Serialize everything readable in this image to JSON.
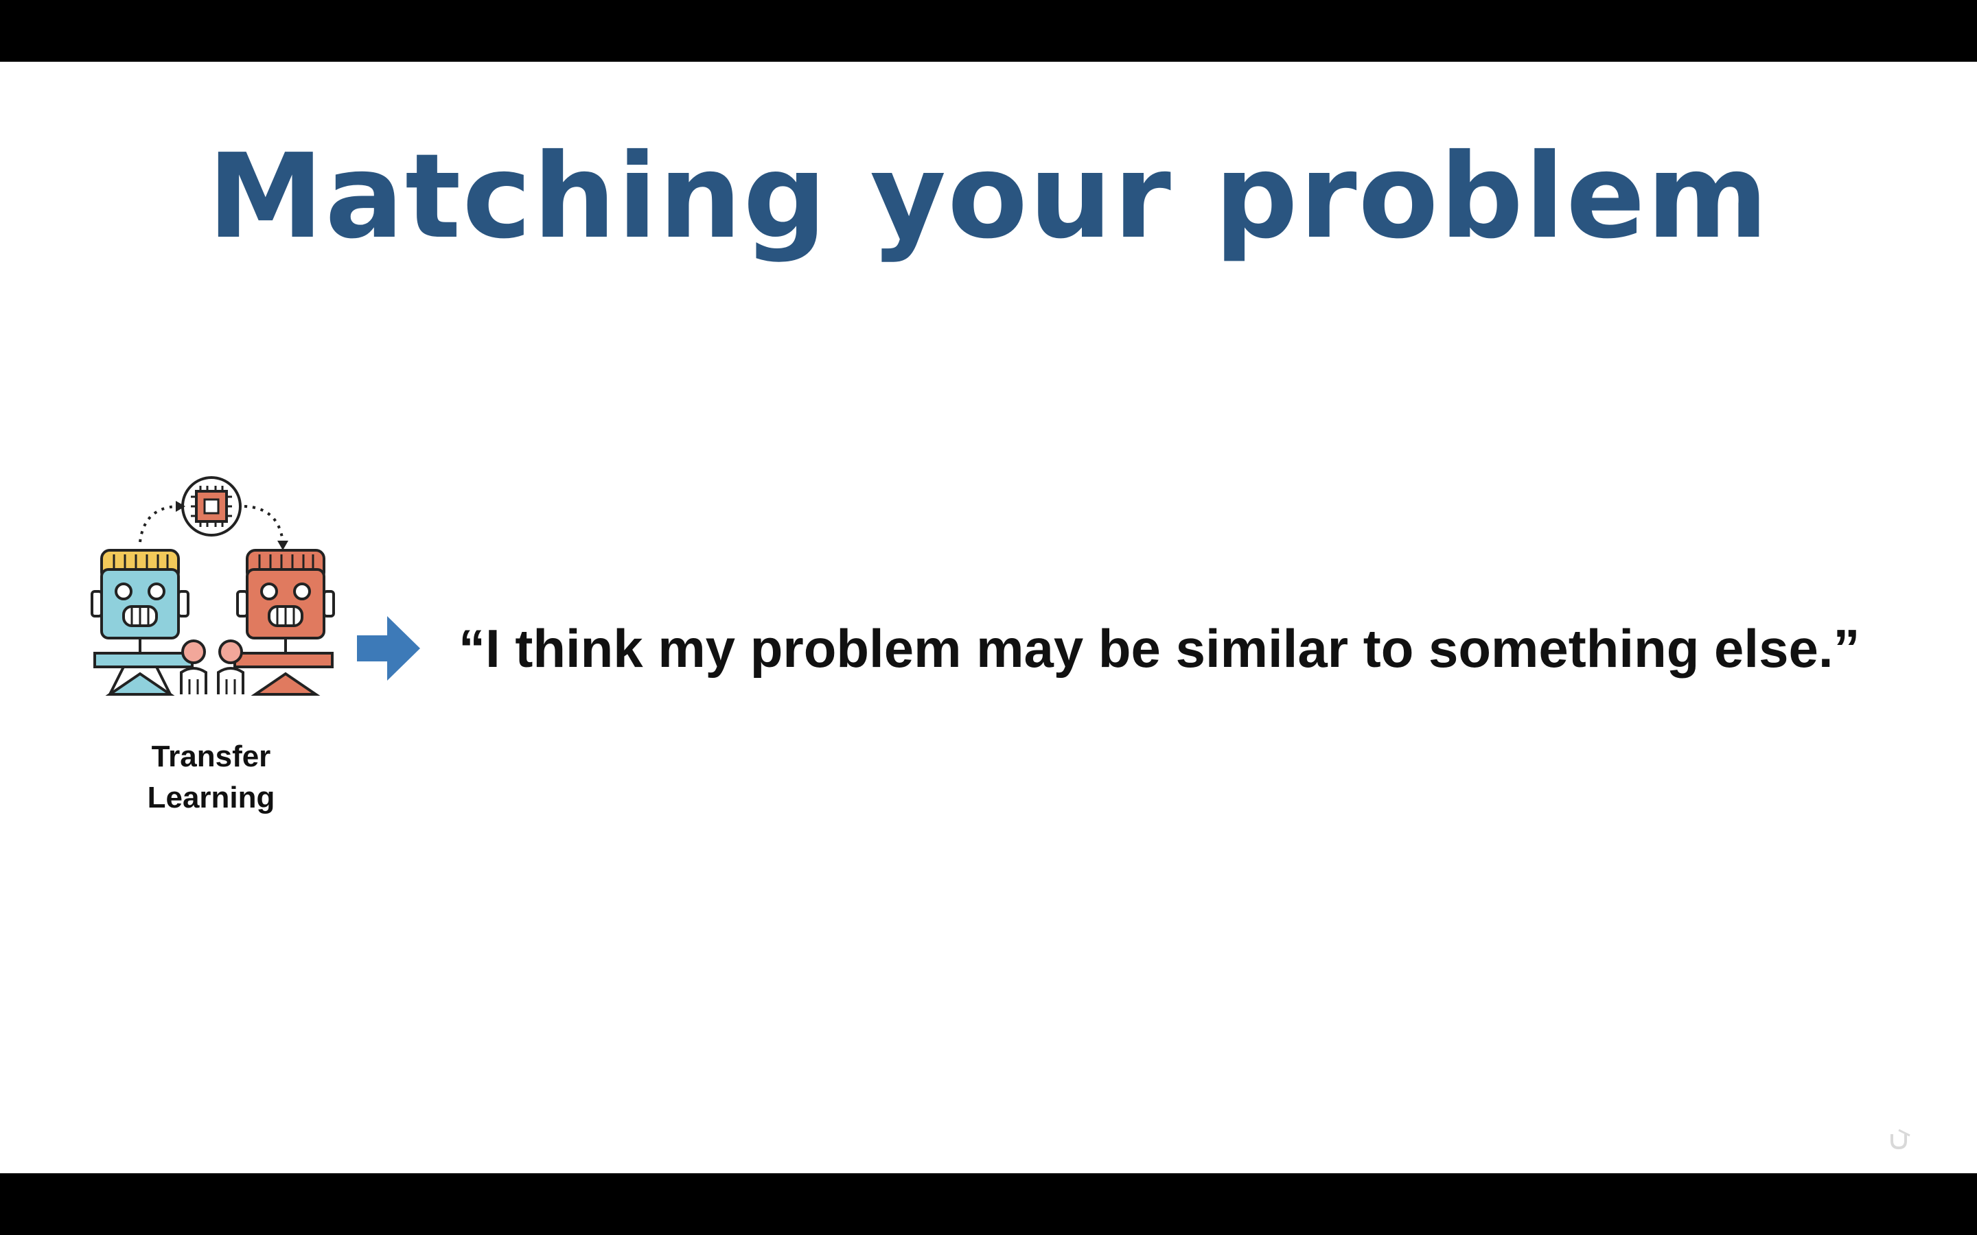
{
  "slide": {
    "title": "Matching your problem",
    "caption_line1": "Transfer",
    "caption_line2": "Learning",
    "quote": "“I think my problem may be similar to something else.”"
  },
  "icons": {
    "illustration": "transfer-learning-robots-icon",
    "arrow": "right-arrow-icon",
    "watermark": "udemy-logo-icon"
  },
  "colors": {
    "title": "#2a5580",
    "arrow": "#3d7ab8",
    "robot_left": "#8fd0dc",
    "robot_right": "#e07a5f",
    "robot_hair": "#f2c95a"
  }
}
